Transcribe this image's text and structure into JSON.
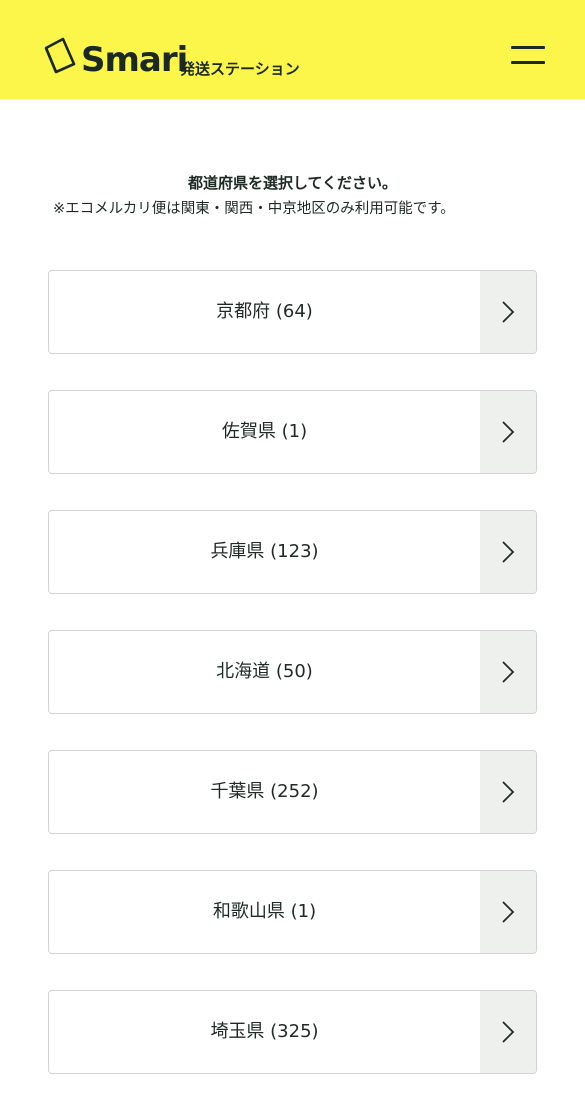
{
  "header": {
    "logo_text": "Smari",
    "logo_sub": "発送ステーション",
    "menu_icon": "hamburger-icon",
    "background_color": "#fdf64a"
  },
  "intro": {
    "title": "都道府県を選択してください。",
    "note": "※エコメルカリ便は関東・関西・中京地区のみ利用可能です。"
  },
  "prefectures": [
    {
      "label": "京都府 (64)"
    },
    {
      "label": "佐賀県 (1)"
    },
    {
      "label": "兵庫県 (123)"
    },
    {
      "label": "北海道 (50)"
    },
    {
      "label": "千葉県 (252)"
    },
    {
      "label": "和歌山県 (1)"
    },
    {
      "label": "埼玉県 (325)"
    }
  ],
  "item_arrow_icon": "chevron-right-icon"
}
